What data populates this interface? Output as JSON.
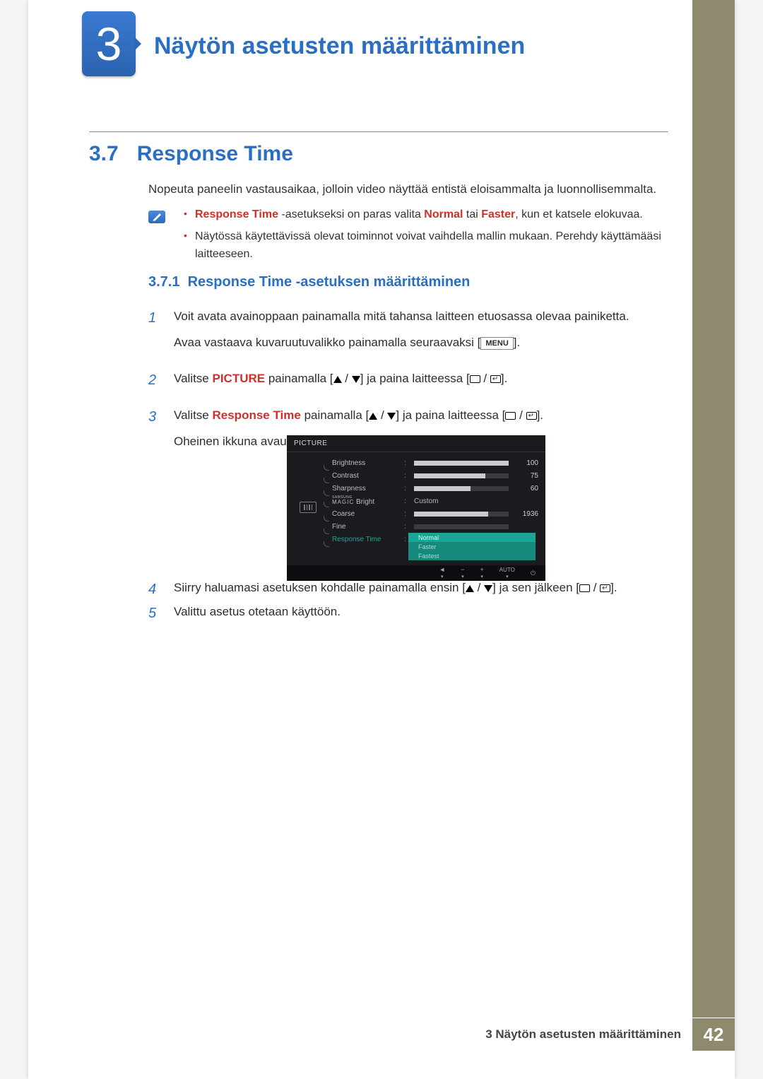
{
  "chapter": {
    "number": "3",
    "title": "Näytön asetusten määrittäminen"
  },
  "section": {
    "number": "3.7",
    "title": "Response Time"
  },
  "intro": "Nopeuta paneelin vastausaikaa, jolloin video näyttää entistä eloisammalta ja luonnollisemmalta.",
  "notes": {
    "item1_a": "Response Time",
    "item1_b": " -asetukseksi on paras valita ",
    "item1_c": "Normal",
    "item1_d": " tai ",
    "item1_e": "Faster",
    "item1_f": ", kun et katsele elokuvaa.",
    "item2": "Näytössä käytettävissä olevat toiminnot voivat vaihdella mallin mukaan. Perehdy käyttämääsi laitteeseen."
  },
  "subsection": {
    "number": "3.7.1",
    "title": "Response Time -asetuksen määrittäminen"
  },
  "steps": {
    "s1a": "Voit avata avainoppaan painamalla mitä tahansa laitteen etuosassa olevaa painiketta.",
    "s1b_a": "Avaa vastaava kuvaruutuvalikko painamalla seuraavaksi [",
    "s1b_menu": "MENU",
    "s1b_b": "].",
    "s2_a": "Valitse ",
    "s2_b": "PICTURE",
    "s2_c": " painamalla [",
    "s2_d": "] ja paina laitteessa [",
    "s2_e": "].",
    "s3_a": "Valitse ",
    "s3_b": "Response Time",
    "s3_c": " painamalla [",
    "s3_d": "] ja paina laitteessa [",
    "s3_e": "].",
    "s3_f": "Oheinen ikkuna avautuu.",
    "s4_a": "Siirry haluamasi asetuksen kohdalle painamalla ensin [",
    "s4_b": "] ja sen jälkeen [",
    "s4_c": "].",
    "s5": "Valittu asetus otetaan käyttöön."
  },
  "osd": {
    "menu_title": "PICTURE",
    "rows": [
      {
        "label": "Brightness",
        "value": "100",
        "fill": 100
      },
      {
        "label": "Contrast",
        "value": "75",
        "fill": 75
      },
      {
        "label": "Sharpness",
        "value": "60",
        "fill": 60
      }
    ],
    "magic_label1": "SAMSUNG",
    "magic_label2": "MAGIC",
    "magic_label3": " Bright",
    "magic_value": "Custom",
    "coarse": {
      "label": "Coarse",
      "value": "1936",
      "fill": 78
    },
    "fine": {
      "label": "Fine"
    },
    "response": {
      "label": "Response Time"
    },
    "options": [
      "Normal",
      "Faster",
      "Fastest"
    ],
    "footer": {
      "back": "◄",
      "minus": "−",
      "plus": "+",
      "auto": "AUTO",
      "power": "⏻"
    }
  },
  "footer": {
    "text": "3 Näytön asetusten määrittäminen",
    "page": "42"
  }
}
